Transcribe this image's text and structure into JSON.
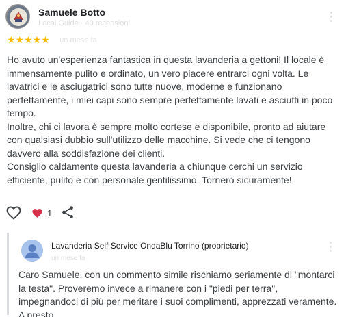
{
  "review": {
    "author": "Samuele Botto",
    "author_meta": "Local Guide · 40 recensioni",
    "rating": 5,
    "stars": "★★★★★",
    "date": "un mese fa",
    "paragraphs": [
      "Ho avuto un'esperienza fantastica in questa lavanderia a gettoni! Il locale è immensamente pulito e ordinato, un vero piacere entrarci ogni volta. Le lavatrici e le asciugatrici sono tutte nuove, moderne e funzionano perfettamente, i miei capi sono sempre perfettamente lavati e asciutti in poco tempo.",
      "Inoltre, chi ci lavora è sempre molto cortese e disponibile, pronto ad aiutare con qualsiasi dubbio sull'utilizzo delle macchine. Si vede che ci tengono davvero alla soddisfazione dei clienti.",
      "Consiglio caldamente questa lavanderia a chiunque cerchi un servizio efficiente, pulito e con personale gentilissimo. Tornerò sicuramente!"
    ],
    "reaction_count": "1",
    "colors": {
      "star": "#fbbc04",
      "heart": "#d6304a"
    }
  },
  "reply": {
    "owner_name": "Lavanderia Self Service OndaBlu Torrino (proprietario)",
    "owner_meta": "un mese fa",
    "text": "Caro Samuele, con un commento simile rischiamo seriamente di \"montarci la testa\". Proveremo invece a rimanere con i \"piedi per terra\", impegnandoci di più per meritare i suoi complimenti, apprezzati veramente. A presto"
  },
  "icons": {
    "avatar": "user-avatar",
    "more": "more-vert-icon",
    "like": "heart-outline-icon",
    "reaction": "heart-filled-icon",
    "share": "share-icon",
    "owner_avatar": "person-icon"
  }
}
